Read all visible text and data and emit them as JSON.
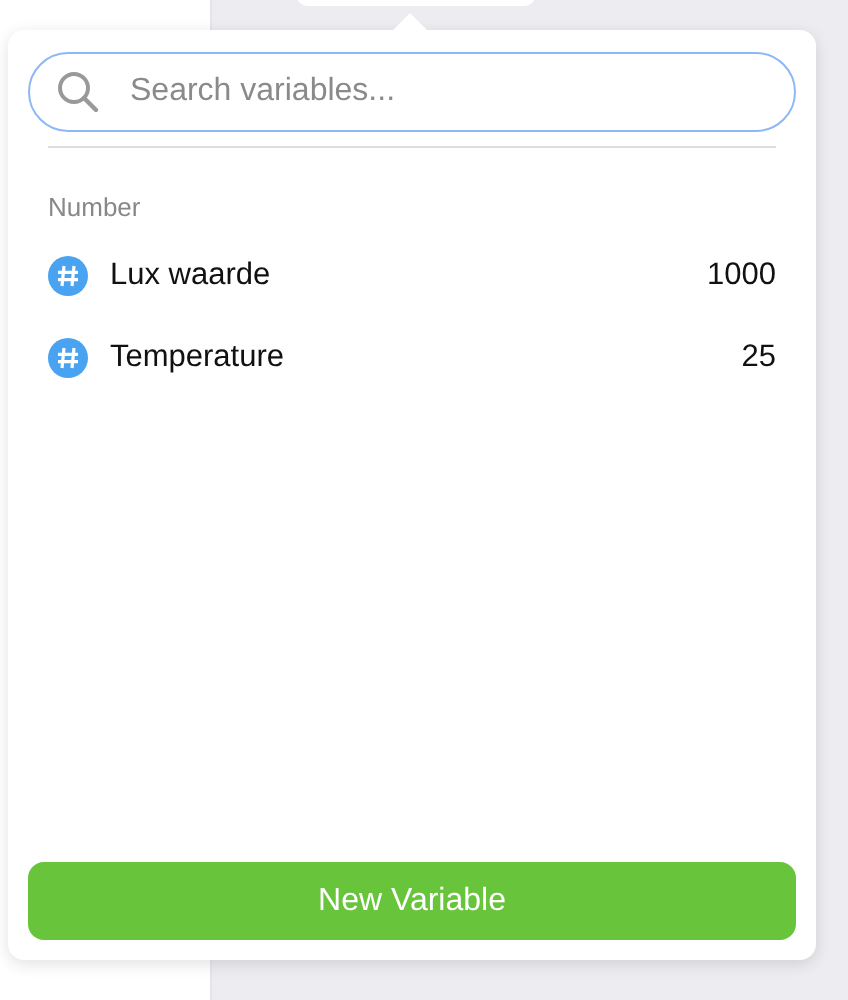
{
  "search": {
    "placeholder": "Search variables..."
  },
  "groups": [
    {
      "title": "Number",
      "variables": [
        {
          "name": "Lux waarde",
          "value": "1000"
        },
        {
          "name": "Temperature",
          "value": "25"
        }
      ]
    }
  ],
  "button": "New Variable"
}
